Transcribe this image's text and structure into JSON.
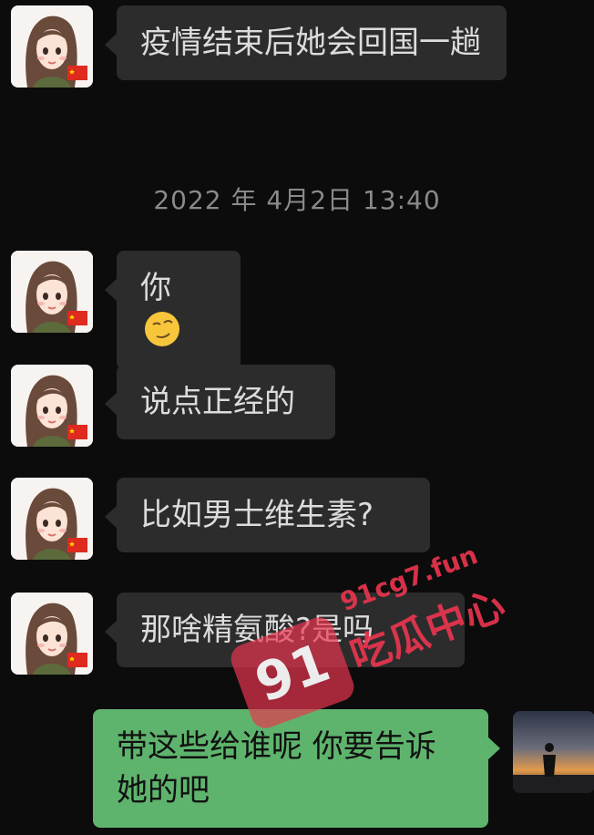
{
  "chat": {
    "messages": [
      {
        "text": "疫情结束后她会回国一趟"
      },
      {
        "text": "你"
      },
      {
        "text": "说点正经的"
      },
      {
        "text": "比如男士维生素?"
      },
      {
        "text": "那啥精氨酸?是吗"
      },
      {
        "text": "带这些给谁呢 你要告诉她的吧"
      }
    ],
    "timestamp": "2022 年 4月2日 13:40"
  },
  "watermark": {
    "number": "91",
    "url": "91cg7.fun",
    "name": "吃瓜中心"
  },
  "icons": {
    "contact_avatar": "cartoon-woman-avatar",
    "emoji": "smirk-emoji",
    "self_avatar": "sunset-silhouette-avatar"
  },
  "colors": {
    "incoming_bubble": "#2c2c2c",
    "outgoing_bubble": "#5eb46d",
    "watermark": "#e8354f"
  }
}
